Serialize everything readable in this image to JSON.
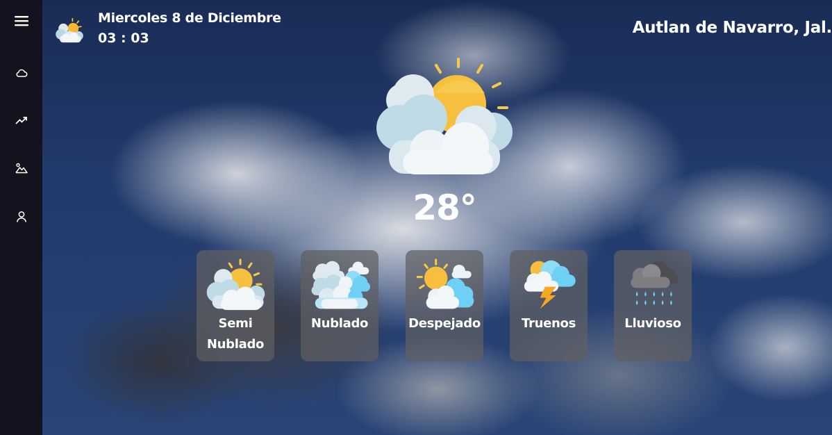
{
  "sidebar": {
    "items": [
      {
        "icon": "menu-icon"
      },
      {
        "icon": "cloud-icon"
      },
      {
        "icon": "trending-up-icon"
      },
      {
        "icon": "landscape-icon"
      },
      {
        "icon": "user-icon"
      }
    ]
  },
  "header": {
    "date": "Miercoles 8 de Diciembre",
    "time": "03 : 03",
    "location": "Autlan de Navarro, Jal.",
    "icon": "partly-cloudy-icon"
  },
  "current": {
    "icon": "partly-cloudy-icon",
    "temperature": "28°"
  },
  "forecast": [
    {
      "label": "Semi Nublado",
      "icon": "partly-cloudy-icon"
    },
    {
      "label": "Nublado",
      "icon": "cloudy-icon"
    },
    {
      "label": "Despejado",
      "icon": "sunny-clouds-icon"
    },
    {
      "label": "Truenos",
      "icon": "thunderstorm-icon"
    },
    {
      "label": "Lluvioso",
      "icon": "rain-icon"
    }
  ],
  "colors": {
    "sidebar": "#12131f",
    "card": "#5f5f62",
    "text": "#ffffff",
    "sun": "#f7b733",
    "cloud": "#eef3f7",
    "cloud_blue": "#6fd0f5"
  }
}
